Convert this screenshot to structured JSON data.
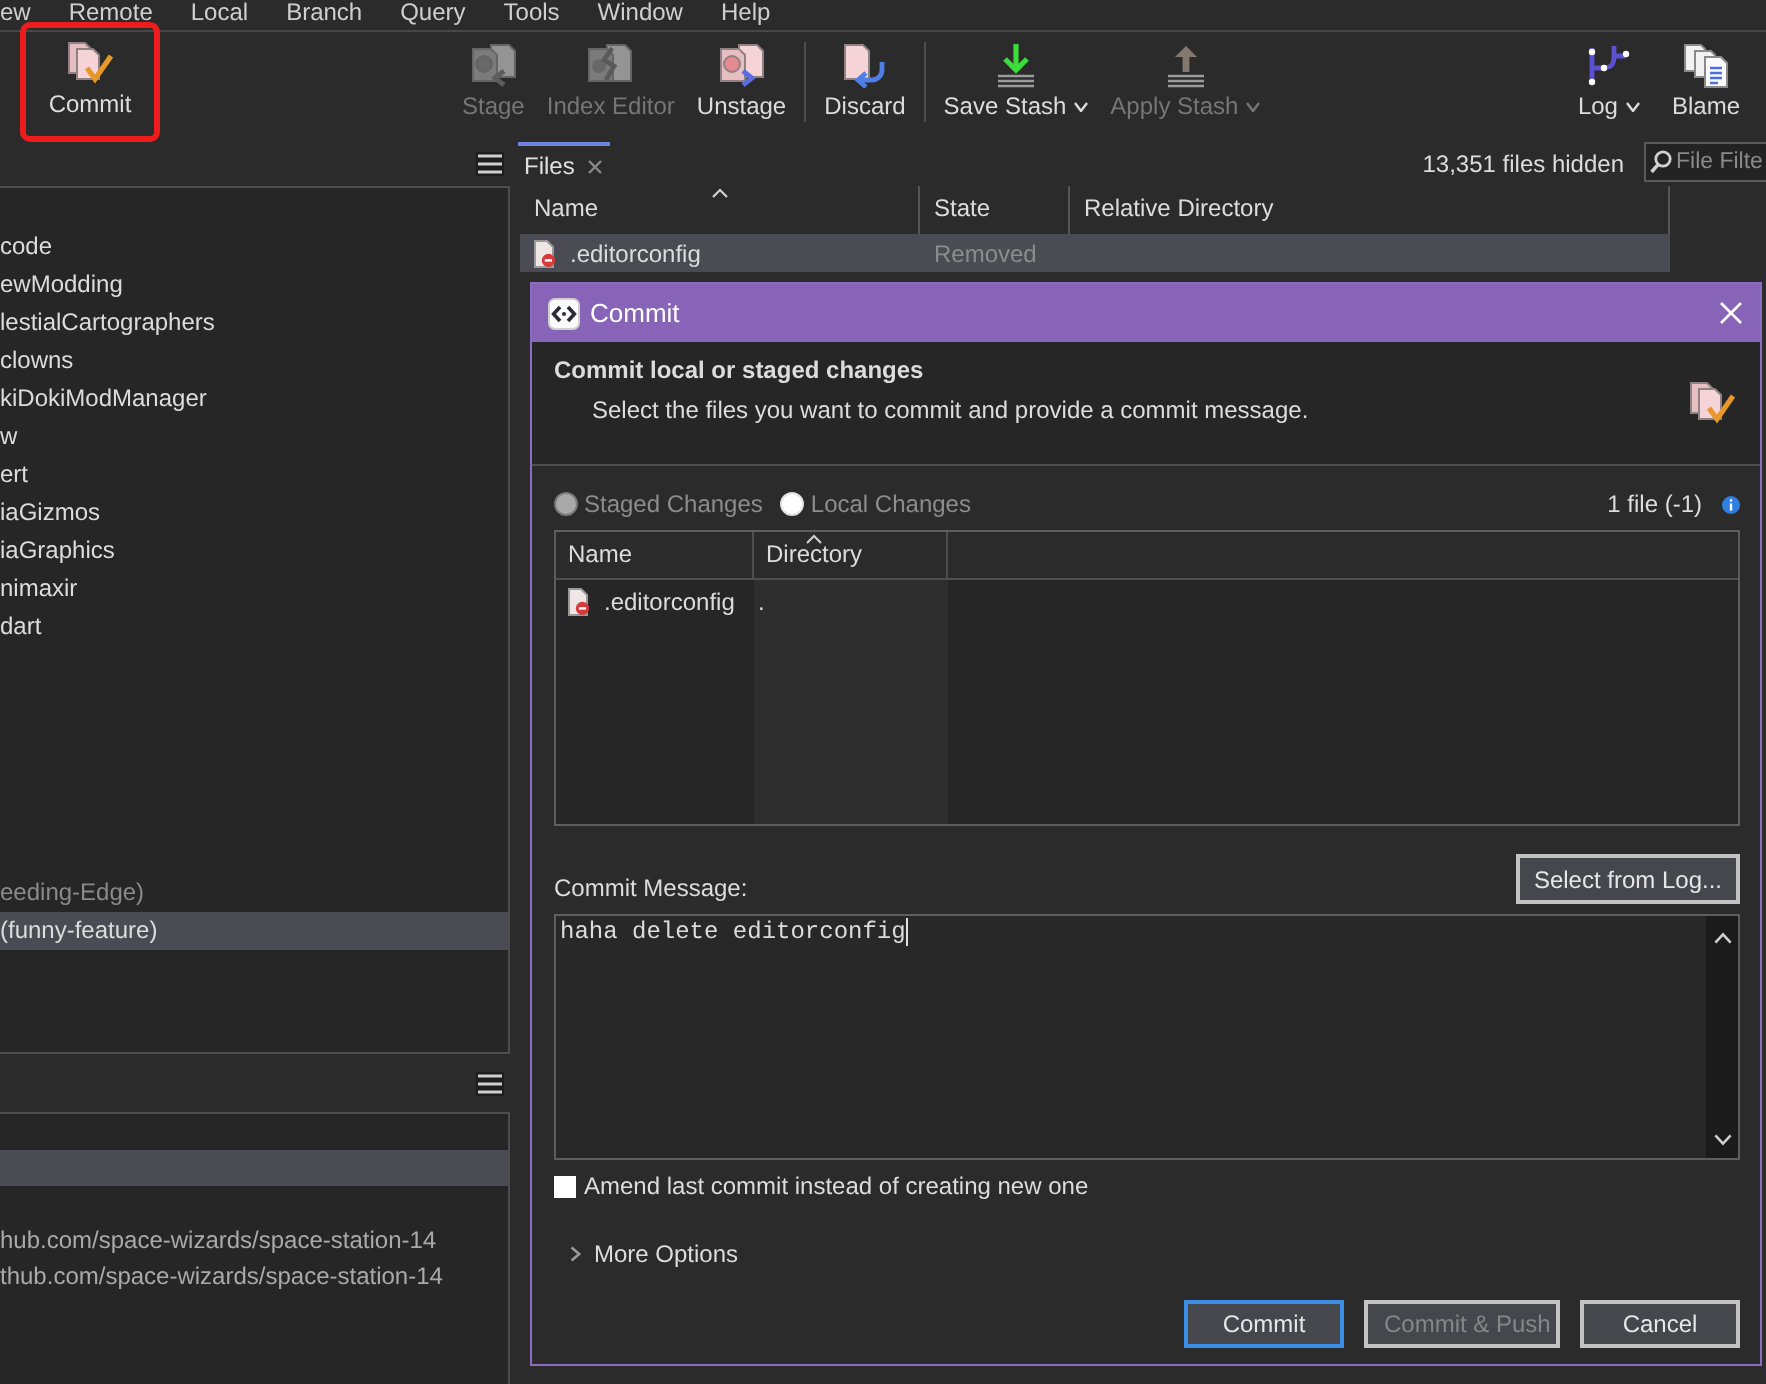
{
  "menu_bar": [
    {
      "label": "ew"
    },
    {
      "label": "Remote"
    },
    {
      "label": "Local"
    },
    {
      "label": "Branch"
    },
    {
      "label": "Query"
    },
    {
      "label": "Tools"
    },
    {
      "label": "Window"
    },
    {
      "label": "Help"
    }
  ],
  "toolbar": {
    "left": [
      {
        "label": "Commit",
        "kind": "commit",
        "disabled": false,
        "dropdown": false,
        "highlighted": true
      }
    ],
    "center": [
      [
        {
          "label": "Stage",
          "kind": "stage",
          "disabled": true,
          "dropdown": false,
          "highlighted": false
        },
        {
          "label": "Index Editor",
          "kind": "index-editor",
          "disabled": true,
          "dropdown": false,
          "highlighted": false
        },
        {
          "label": "Unstage",
          "kind": "unstage",
          "disabled": false,
          "dropdown": false,
          "highlighted": false
        }
      ],
      [
        {
          "label": "Discard",
          "kind": "discard",
          "disabled": false,
          "dropdown": false,
          "highlighted": false
        }
      ],
      [
        {
          "label": "Save Stash",
          "kind": "save-stash",
          "disabled": false,
          "dropdown": true,
          "highlighted": false
        },
        {
          "label": "Apply Stash",
          "kind": "apply-stash",
          "disabled": true,
          "dropdown": true,
          "highlighted": false
        }
      ]
    ],
    "right": [
      {
        "label": "Log",
        "kind": "log",
        "disabled": false,
        "dropdown": true,
        "highlighted": false
      },
      {
        "label": "Blame",
        "kind": "blame",
        "disabled": false,
        "dropdown": false,
        "highlighted": false
      }
    ]
  },
  "repository_tree": {
    "groups": [
      {
        "items": [
          {
            "label": "code",
            "selected": false,
            "disabled": false
          },
          {
            "label": "ewModding",
            "selected": false,
            "disabled": false
          },
          {
            "label": "lestialCartographers",
            "selected": false,
            "disabled": false
          },
          {
            "label": "clowns",
            "selected": false,
            "disabled": false
          },
          {
            "label": "kiDokiModManager",
            "selected": false,
            "disabled": false
          },
          {
            "label": "w",
            "selected": false,
            "disabled": false
          },
          {
            "label": "ert",
            "selected": false,
            "disabled": false
          },
          {
            "label": "iaGizmos",
            "selected": false,
            "disabled": false
          },
          {
            "label": "iaGraphics",
            "selected": false,
            "disabled": false
          },
          {
            "label": "nimaxir",
            "selected": false,
            "disabled": false
          },
          {
            "label": "dart",
            "selected": false,
            "disabled": false
          }
        ]
      },
      {
        "items": [
          {
            "label": "eeding-Edge)",
            "selected": false,
            "disabled": true
          },
          {
            "label": "(funny-feature)",
            "selected": true,
            "disabled": false
          }
        ]
      }
    ]
  },
  "remotes_list": {
    "rows": [
      {
        "selected": false
      },
      {
        "selected": true
      },
      {
        "selected": false
      },
      {
        "text": "hub.com/space-wizards/space-station-14",
        "selected": false
      },
      {
        "text": "thub.com/space-wizards/space-station-14",
        "selected": false
      }
    ]
  },
  "files_tab": {
    "label": "Files",
    "selected": true
  },
  "hidden_count": "13,351 files hidden",
  "filter": {
    "placeholder": "File Filte"
  },
  "files_table": {
    "columns": [
      {
        "label": "Name",
        "sorted": true
      },
      {
        "label": "State",
        "sorted": false
      },
      {
        "label": "Relative Directory",
        "sorted": false
      }
    ],
    "rows": [
      {
        "name": ".editorconfig",
        "state": "Removed",
        "selected": true
      }
    ]
  },
  "dialog": {
    "title": "Commit",
    "heading": "Commit local or staged changes",
    "description": "Select the files you want to commit and provide a commit message.",
    "source_options": [
      {
        "label": "Staged Changes",
        "selected": false
      },
      {
        "label": "Local Changes",
        "selected": true
      }
    ],
    "file_count": "1 file (-1)",
    "file_list": {
      "columns": [
        {
          "label": "Name",
          "sorted": false
        },
        {
          "label": "Directory",
          "sorted": true
        }
      ],
      "rows": [
        {
          "name": ".editorconfig",
          "directory": "."
        }
      ]
    },
    "message_label": "Commit Message:",
    "select_from_log": "Select from Log...",
    "message": {
      "value": "haha delete editorconfig"
    },
    "amend": {
      "label": "Amend last commit instead of creating new one",
      "checked": false
    },
    "more_options": {
      "label": "More Options",
      "expanded": false
    },
    "buttons": [
      {
        "label": "Commit",
        "default": true,
        "disabled": false
      },
      {
        "label": "Commit & Push",
        "default": false,
        "disabled": true
      },
      {
        "label": "Cancel",
        "default": false,
        "disabled": false
      }
    ]
  }
}
